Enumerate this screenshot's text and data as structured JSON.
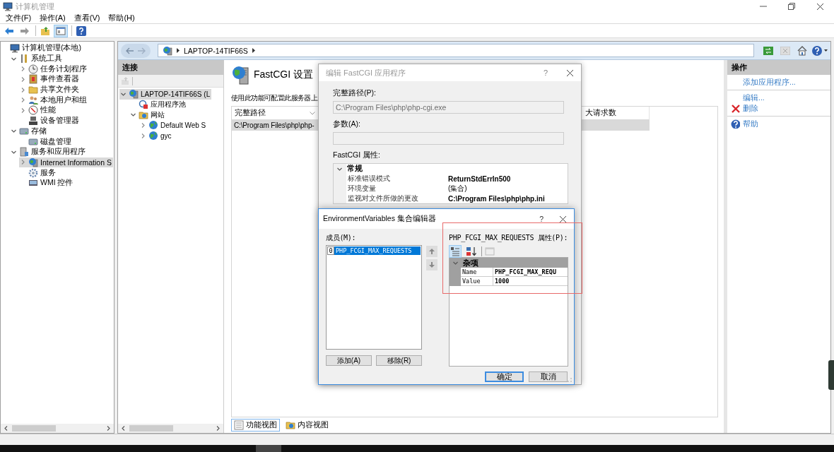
{
  "window": {
    "title": "计算机管理"
  },
  "menu": [
    "文件(F)",
    "操作(A)",
    "查看(V)",
    "帮助(H)"
  ],
  "toolbar": [
    {
      "kind": "back",
      "on": false
    },
    {
      "kind": "forward",
      "on": false
    },
    {
      "kind": "up",
      "on": false
    },
    {
      "kind": "tree",
      "on": true
    },
    {
      "kind": "help",
      "on": false
    }
  ],
  "tree": [
    {
      "label": "计算机管理(本地)",
      "selected": false,
      "children": [
        {
          "label": "系统工具",
          "expanded": true,
          "selected": false,
          "children": [
            {
              "label": "任务计划程序",
              "expanded": false,
              "selected": false
            },
            {
              "label": "事件查看器",
              "expanded": false,
              "selected": false
            },
            {
              "label": "共享文件夹",
              "expanded": false,
              "selected": false
            },
            {
              "label": "本地用户和组",
              "expanded": false,
              "selected": false
            },
            {
              "label": "性能",
              "expanded": false,
              "selected": false
            },
            {
              "label": "设备管理器",
              "selected": false
            }
          ]
        },
        {
          "label": "存储",
          "expanded": true,
          "selected": false,
          "children": [
            {
              "label": "磁盘管理",
              "selected": false
            }
          ]
        },
        {
          "label": "服务和应用程序",
          "expanded": true,
          "selected": false,
          "children": [
            {
              "label": "Internet Information S",
              "expanded": false,
              "selected": true
            },
            {
              "label": "服务",
              "selected": false
            },
            {
              "label": "WMI 控件",
              "selected": false
            }
          ]
        }
      ]
    }
  ],
  "iis": {
    "breadcrumb": "LAPTOP-14TIF66S",
    "connections": {
      "title": "连接",
      "tree": [
        {
          "label": "LAPTOP-14TIF66S (L",
          "expanded": true,
          "selected": true,
          "children": [
            {
              "label": "应用程序池",
              "selected": false
            },
            {
              "label": "网站",
              "expanded": true,
              "selected": false,
              "children": [
                {
                  "label": "Default Web S",
                  "expanded": false,
                  "selected": false
                },
                {
                  "label": "gyc",
                  "expanded": false,
                  "selected": false
                }
              ]
            }
          ]
        }
      ]
    },
    "feature": {
      "title": "FastCGI 设置",
      "description": "使用此功能可配置此服务器上",
      "columns": [
        "完整路径",
        "大请求数"
      ],
      "rows": [
        {
          "cells": [
            "C:\\Program Files\\php\\php-"
          ],
          "selected": true
        }
      ]
    },
    "view_tabs": [
      {
        "label": "功能视图",
        "selected": true
      },
      {
        "label": "内容视图",
        "selected": false
      }
    ],
    "actions": {
      "title": "操作",
      "groups": [
        [
          {
            "label": "添加应用程序...",
            "kind": "plain"
          }
        ],
        [
          {
            "label": "编辑...",
            "kind": "plain"
          },
          {
            "label": "删除",
            "kind": "delete"
          }
        ],
        [
          {
            "label": "帮助",
            "kind": "help"
          }
        ]
      ]
    }
  },
  "fastcgi_dialog": {
    "title": "编辑 FastCGI 应用程序",
    "help_button": "?",
    "fields": [
      {
        "label": "完整路径(P):",
        "value": "C:\\Program Files\\php\\php-cgi.exe",
        "disabled": true
      },
      {
        "label": "参数(A):",
        "disabled": true
      }
    ],
    "properties_label": "FastCGI 属性:",
    "grid": {
      "category": "常规",
      "expanded": true,
      "rows": [
        {
          "name": "标准错误模式",
          "value": "ReturnStdErrIn500",
          "modified": true
        },
        {
          "name": "环境变量",
          "value": "(集合)",
          "modified": false
        },
        {
          "name": "监视对文件所做的更改",
          "value": "C:\\Program Files\\php\\php.ini",
          "modified": true
        }
      ]
    }
  },
  "env_dialog": {
    "title": "EnvironmentVariables 集合编辑器",
    "help_button": "?",
    "members_label": "成员(M):",
    "members": [
      {
        "index": "0",
        "name": "PHP_FCGI_MAX_REQUESTS",
        "selected": true
      }
    ],
    "buttons": [
      "添加(A)",
      "移除(R)"
    ],
    "properties_label": "PHP_FCGI_MAX_REQUESTS 属性(P):",
    "grid": {
      "category": "杂项",
      "expanded": true,
      "rows": [
        {
          "name": "Name",
          "value": "PHP_FCGI_MAX_REQU",
          "modified": true
        },
        {
          "name": "Value",
          "value": "1000",
          "modified": true
        }
      ]
    },
    "footer_buttons": [
      {
        "label": "确定",
        "default": true
      },
      {
        "label": "取消",
        "default": false
      }
    ]
  }
}
